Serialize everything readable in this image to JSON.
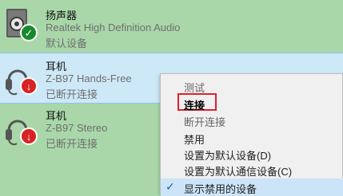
{
  "devices": [
    {
      "name": "扬声器",
      "description": "Realtek High Definition Audio",
      "status": "默认设备",
      "icon": "speaker-icon",
      "badge": "check-badge-icon"
    },
    {
      "name": "耳机",
      "description": "Z-B97 Hands-Free",
      "status": "已断开连接",
      "icon": "headset-icon",
      "badge": "disconnected-arrow-icon"
    },
    {
      "name": "耳机",
      "description": "Z-B97 Stereo",
      "status": "已断开连接",
      "icon": "headset-icon",
      "badge": "disconnected-arrow-icon"
    }
  ],
  "context_menu": {
    "items": [
      {
        "label": "测试",
        "state": "disabled"
      },
      {
        "label": "连接",
        "state": "bold-highlighted"
      },
      {
        "label": "断开连接",
        "state": "disabled"
      },
      {
        "label": "禁用",
        "state": "enabled"
      },
      {
        "label": "设置为默认设备(D)",
        "state": "enabled"
      },
      {
        "label": "设置为默认通信设备(C)",
        "state": "enabled"
      },
      {
        "label": "显示禁用的设备",
        "state": "checked"
      }
    ]
  },
  "colors": {
    "background": "#a9d7a9",
    "selected_row": "#cde8f7",
    "menu_background": "#f0f0f0",
    "highlight_box": "#e0212a",
    "ok_badge": "#178a2e",
    "disconnected_badge": "#d72323"
  }
}
